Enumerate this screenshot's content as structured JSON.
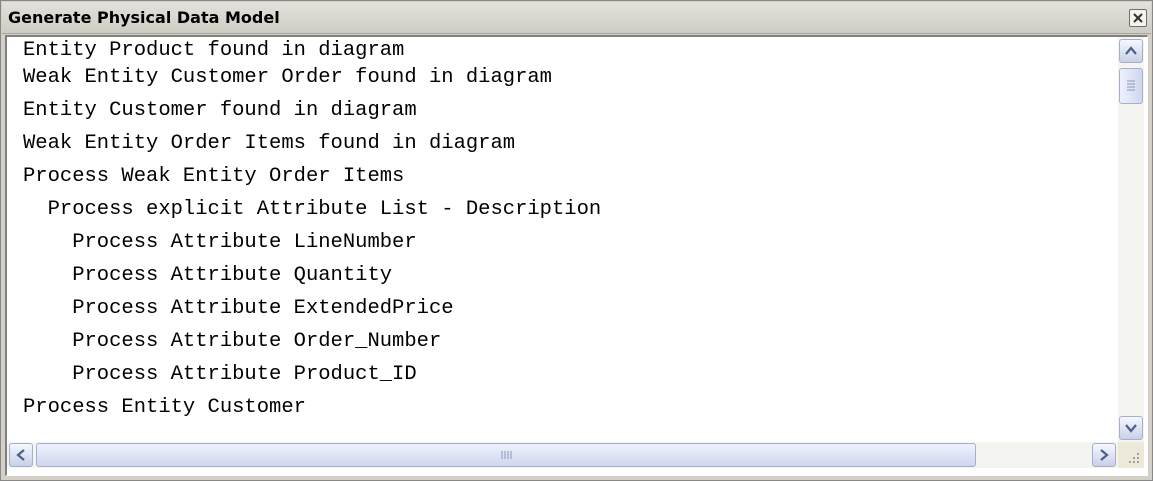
{
  "window": {
    "title": "Generate Physical Data Model",
    "close_icon": "close-icon"
  },
  "log": {
    "lines": [
      "Entity Product found in diagram",
      "Weak Entity Customer Order found in diagram",
      "Entity Customer found in diagram",
      "Weak Entity Order Items found in diagram",
      "Process Weak Entity Order Items",
      "  Process explicit Attribute List - Description",
      "    Process Attribute LineNumber",
      "    Process Attribute Quantity",
      "    Process Attribute ExtendedPrice",
      "    Process Attribute Order_Number",
      "    Process Attribute Product_ID",
      "Process Entity Customer"
    ]
  },
  "scrollbars": {
    "vertical_up_icon": "chevron-up-icon",
    "vertical_down_icon": "chevron-down-icon",
    "horizontal_left_icon": "chevron-left-icon",
    "horizontal_right_icon": "chevron-right-icon",
    "accent": "#a4b0cc"
  }
}
